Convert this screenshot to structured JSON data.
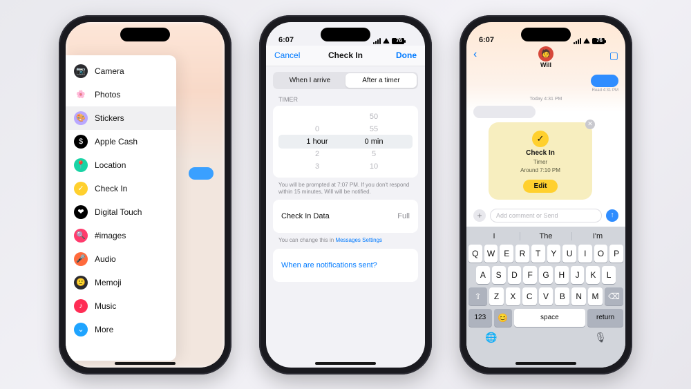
{
  "status": {
    "time": "6:07",
    "battery_pct": "76"
  },
  "phone1": {
    "apps": [
      {
        "label": "Camera",
        "icon": "📷",
        "bg": "#2b2b2f"
      },
      {
        "label": "Photos",
        "icon": "🌸",
        "bg": "#ffffff"
      },
      {
        "label": "Stickers",
        "icon": "🎨",
        "bg": "#b9a7ff"
      },
      {
        "label": "Apple Cash",
        "icon": "$",
        "bg": "#000"
      },
      {
        "label": "Location",
        "icon": "📍",
        "bg": "#19d3a5"
      },
      {
        "label": "Check In",
        "icon": "✓",
        "bg": "#ffd02e"
      },
      {
        "label": "Digital Touch",
        "icon": "❤",
        "bg": "#000"
      },
      {
        "label": "#images",
        "icon": "🔍",
        "bg": "#ff3b6d"
      },
      {
        "label": "Audio",
        "icon": "🎤",
        "bg": "#ff6a3c"
      },
      {
        "label": "Memoji",
        "icon": "🙂",
        "bg": "#2b2b2f"
      },
      {
        "label": "Music",
        "icon": "♪",
        "bg": "#ff2d55"
      },
      {
        "label": "More",
        "icon": "⌄",
        "bg": "#1fa4ff"
      }
    ]
  },
  "phone2": {
    "nav": {
      "cancel": "Cancel",
      "title": "Check In",
      "done": "Done"
    },
    "segments": {
      "a": "When I arrive",
      "b": "After a timer"
    },
    "timer_label": "TIMER",
    "picker": {
      "hours": [
        "",
        "0",
        "1",
        "2",
        "3"
      ],
      "h_unit": "hour",
      "mins": [
        "50",
        "55",
        "0",
        "5",
        "10"
      ],
      "m_unit": "min"
    },
    "hint": "You will be prompted at 7:07 PM. If you don't respond within 15 minutes, Will will be notified.",
    "data_row": {
      "label": "Check In Data",
      "value": "Full"
    },
    "settings_hint": "You can change this in ",
    "settings_link": "Messages Settings",
    "notif_link": "When are notifications sent?"
  },
  "phone3": {
    "contact": "Will",
    "read": "Read 4:31 PM",
    "today": "Today 4:31 PM",
    "card": {
      "title": "Check In",
      "l1": "Timer",
      "l2": "Around 7:10 PM",
      "edit": "Edit"
    },
    "compose_placeholder": "Add comment or Send",
    "suggest": [
      "I",
      "The",
      "I'm"
    ],
    "rows": [
      [
        "Q",
        "W",
        "E",
        "R",
        "T",
        "Y",
        "U",
        "I",
        "O",
        "P"
      ],
      [
        "A",
        "S",
        "D",
        "F",
        "G",
        "H",
        "J",
        "K",
        "L"
      ],
      [
        "Z",
        "X",
        "C",
        "V",
        "B",
        "N",
        "M"
      ]
    ],
    "num_key": "123",
    "space": "space",
    "return": "return"
  }
}
